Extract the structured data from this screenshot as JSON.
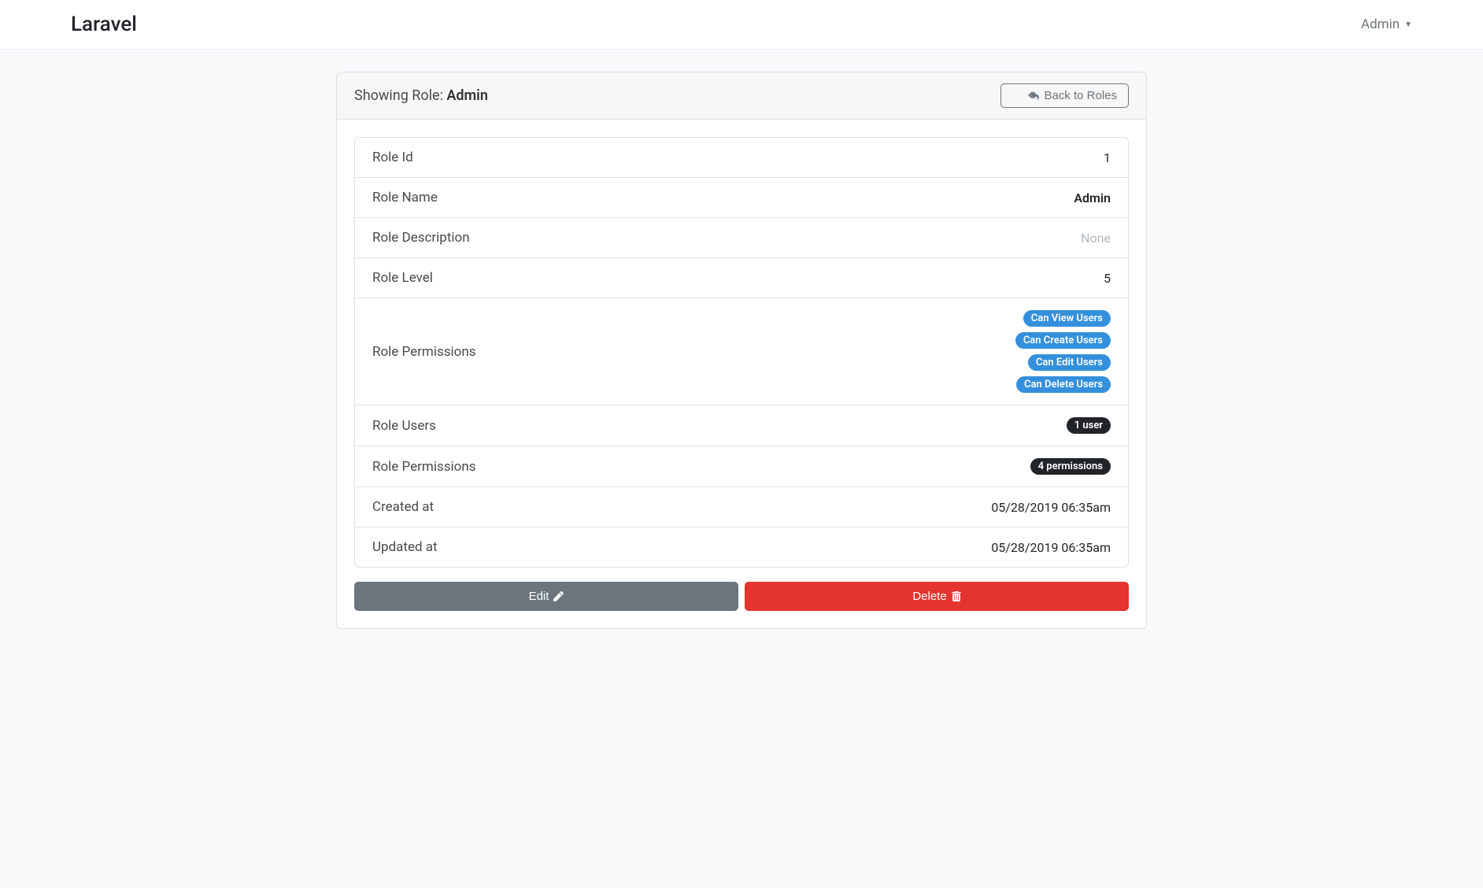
{
  "navbar": {
    "brand": "Laravel",
    "user": "Admin"
  },
  "header": {
    "prefix": "Showing Role: ",
    "role": "Admin",
    "back_btn": "Back to Roles"
  },
  "details": {
    "id_label": "Role Id",
    "id_value": "1",
    "name_label": "Role Name",
    "name_value": "Admin",
    "desc_label": "Role Description",
    "desc_value": "None",
    "level_label": "Role Level",
    "level_value": "5",
    "perm_label": "Role Permissions",
    "perm_badges": [
      "Can View Users",
      "Can Create Users",
      "Can Edit Users",
      "Can Delete Users"
    ],
    "users_label": "Role Users",
    "users_value": "1 user",
    "perm_count_label": "Role Permissions",
    "perm_count_value": "4 permissions",
    "created_label": "Created at",
    "created_value": "05/28/2019 06:35am",
    "updated_label": "Updated at",
    "updated_value": "05/28/2019 06:35am"
  },
  "buttons": {
    "edit": "Edit",
    "delete": "Delete"
  }
}
